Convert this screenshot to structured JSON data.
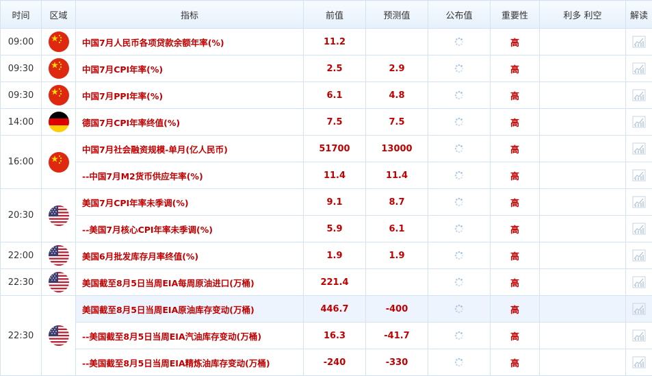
{
  "header": {
    "time": "时间",
    "region": "区域",
    "indicator": "指标",
    "previous": "前值",
    "forecast": "预测值",
    "actual": "公布值",
    "importance": "重要性",
    "effect": "利多 利空",
    "read": "解读"
  },
  "groups": [
    {
      "time": "09:00",
      "flag": "china-flag",
      "rows": [
        {
          "name": "中国7月人民币各项贷款余额年率(%)",
          "prev": "11.2",
          "fcst": "",
          "imp": "高"
        }
      ]
    },
    {
      "time": "09:30",
      "flag": "china-flag",
      "rows": [
        {
          "name": "中国7月CPI年率(%)",
          "prev": "2.5",
          "fcst": "2.9",
          "imp": "高"
        }
      ]
    },
    {
      "time": "09:30",
      "flag": "china-flag",
      "rows": [
        {
          "name": "中国7月PPI年率(%)",
          "prev": "6.1",
          "fcst": "4.8",
          "imp": "高"
        }
      ]
    },
    {
      "time": "14:00",
      "flag": "germany-flag",
      "rows": [
        {
          "name": "德国7月CPI年率终值(%)",
          "prev": "7.5",
          "fcst": "7.5",
          "imp": "高"
        }
      ]
    },
    {
      "time": "16:00",
      "flag": "china-flag",
      "rows": [
        {
          "name": "中国7月社会融资规模-单月(亿人民币)",
          "prev": "51700",
          "fcst": "13000",
          "imp": "高"
        },
        {
          "name": "--中国7月M2货币供应年率(%)",
          "prev": "11.4",
          "fcst": "11.4",
          "imp": "高"
        }
      ]
    },
    {
      "time": "20:30",
      "flag": "usa-flag",
      "rows": [
        {
          "name": "美国7月CPI年率未季调(%)",
          "prev": "9.1",
          "fcst": "8.7",
          "imp": "高"
        },
        {
          "name": "--美国7月核心CPI年率未季调(%)",
          "prev": "5.9",
          "fcst": "6.1",
          "imp": "高"
        }
      ]
    },
    {
      "time": "22:00",
      "flag": "usa-flag",
      "rows": [
        {
          "name": "美国6月批发库存月率终值(%)",
          "prev": "1.9",
          "fcst": "1.9",
          "imp": "高"
        }
      ]
    },
    {
      "time": "22:30",
      "flag": "usa-flag",
      "rows": [
        {
          "name": "美国截至8月5日当周EIA每周原油进口(万桶)",
          "prev": "221.4",
          "fcst": "",
          "imp": "高"
        }
      ]
    },
    {
      "time": "22:30",
      "flag": "usa-flag",
      "rows": [
        {
          "name": "美国截至8月5日当周EIA原油库存变动(万桶)",
          "prev": "446.7",
          "fcst": "-400",
          "imp": "高",
          "highlight": true
        },
        {
          "name": "--美国截至8月5日当周EIA汽油库存变动(万桶)",
          "prev": "16.3",
          "fcst": "-41.7",
          "imp": "高"
        },
        {
          "name": "--美国截至8月5日当周EIA精炼油库存变动(万桶)",
          "prev": "-240",
          "fcst": "-330",
          "imp": "高"
        }
      ]
    }
  ],
  "colors": {
    "value_red": "#c00000",
    "border": "#d4e3f3",
    "header_bg": "#e6f0fb",
    "highlight_row": "#eef4fd"
  }
}
